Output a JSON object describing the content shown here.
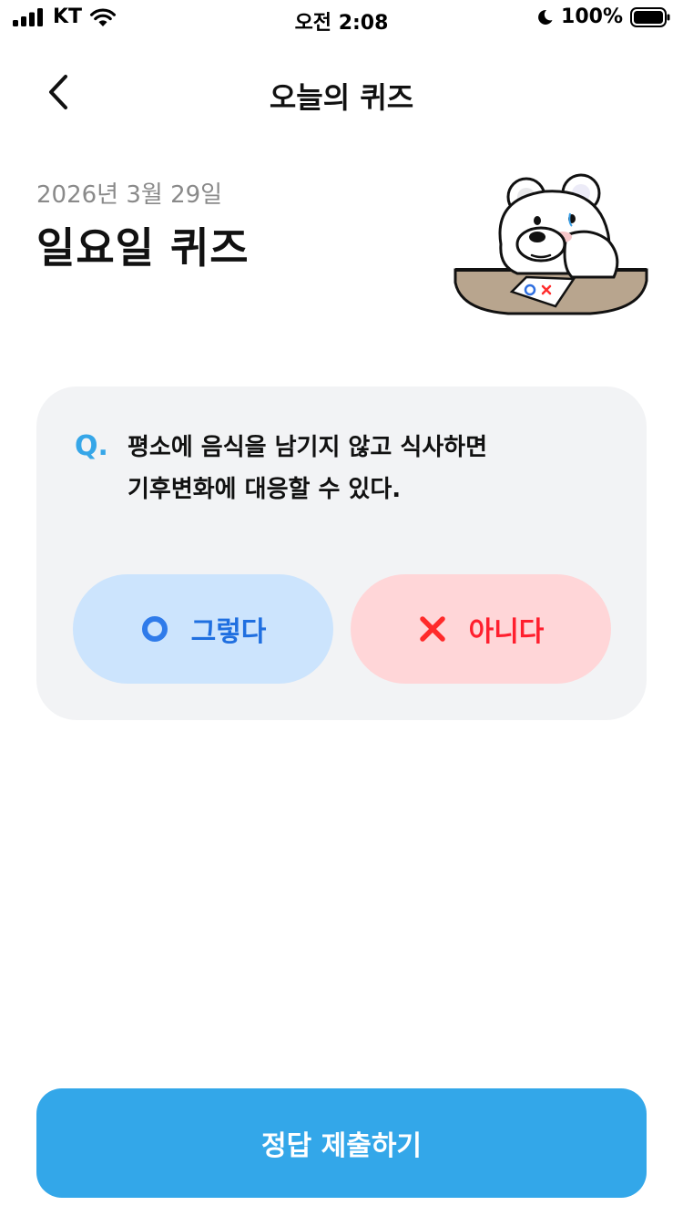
{
  "status_bar": {
    "carrier": "KT",
    "time": "오전 2:08",
    "battery": "100%",
    "icons": [
      "signal-icon",
      "wifi-icon",
      "moon-icon",
      "battery-icon"
    ]
  },
  "nav": {
    "title": "오늘의 퀴즈",
    "back_icon": "chevron-left-icon"
  },
  "header": {
    "date": "2026년 3월 29일",
    "title": "일요일 퀴즈",
    "mascot_card_text": "OX"
  },
  "question": {
    "mark": "Q.",
    "line1": "평소에 음식을 남기지 않고 식사하면",
    "line2": "기후변화에 대응할 수 있다."
  },
  "answers": {
    "yes_label": "그렇다",
    "yes_icon": "circle-o-icon",
    "no_label": "아니다",
    "no_icon": "x-mark-icon"
  },
  "submit": {
    "label": "정답 제출하기"
  },
  "colors": {
    "accent": "#33a7e9",
    "card_bg": "#f2f3f5",
    "yes_bg": "#cce4fd",
    "yes_text": "#1f6fe0",
    "no_bg": "#ffd6d8",
    "no_text": "#ff1f2e"
  }
}
